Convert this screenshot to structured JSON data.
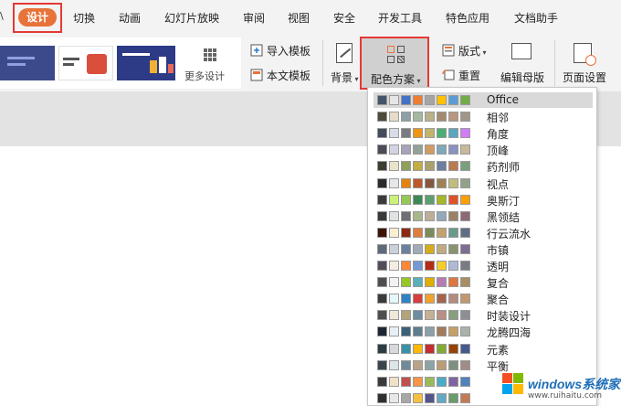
{
  "menubar": {
    "left_glyph": "\\",
    "items": [
      {
        "label": "设计",
        "active": true
      },
      {
        "label": "切换"
      },
      {
        "label": "动画"
      },
      {
        "label": "幻灯片放映"
      },
      {
        "label": "审阅"
      },
      {
        "label": "视图"
      },
      {
        "label": "安全"
      },
      {
        "label": "开发工具"
      },
      {
        "label": "特色应用"
      },
      {
        "label": "文档助手"
      }
    ]
  },
  "ribbon": {
    "more_design_label": "更多设计",
    "import_template_label": "导入模板",
    "this_template_label": "本文模板",
    "background_label": "背景",
    "color_scheme_label": "配色方案",
    "layout_label": "版式",
    "reset_label": "重置",
    "edit_master_label": "编辑母版",
    "page_setup_label": "页面设置"
  },
  "color_schemes": [
    {
      "name": "Office",
      "selected": true,
      "colors": [
        "#44546a",
        "#e7e6e6",
        "#4472c4",
        "#ed7d31",
        "#a5a5a5",
        "#ffc000",
        "#5b9bd5",
        "#70ad47"
      ]
    },
    {
      "name": "相邻",
      "colors": [
        "#4f4a3b",
        "#e6ddc8",
        "#8da0a8",
        "#a4b8a2",
        "#b9b089",
        "#a48a6e",
        "#b99780",
        "#a0968a"
      ]
    },
    {
      "name": "角度",
      "colors": [
        "#434b5c",
        "#d7dde8",
        "#797b7e",
        "#f09415",
        "#c1b56b",
        "#4baf73",
        "#5aa6c0",
        "#d17df9"
      ]
    },
    {
      "name": "顶峰",
      "colors": [
        "#4d4b55",
        "#d2d5e1",
        "#a7a3b9",
        "#93a299",
        "#cf9c66",
        "#7fa8b8",
        "#8a92c0",
        "#c5b99a"
      ]
    },
    {
      "name": "药剂师",
      "colors": [
        "#3a3f2f",
        "#e8e3c9",
        "#8fa05a",
        "#c2ad45",
        "#a9a26a",
        "#6c7f9e",
        "#ba7a4f",
        "#7a9f7f"
      ]
    },
    {
      "name": "视点",
      "colors": [
        "#2b2b2b",
        "#e5e8ea",
        "#e48312",
        "#bd582c",
        "#865640",
        "#9b8357",
        "#c2bc80",
        "#94a088"
      ]
    },
    {
      "name": "奥斯汀",
      "colors": [
        "#3b3b3b",
        "#caf278",
        "#94c954",
        "#3e8853",
        "#5d9f6f",
        "#a6b727",
        "#df5327",
        "#fe9e00"
      ]
    },
    {
      "name": "黑领结",
      "colors": [
        "#3a3a3a",
        "#dfe3e5",
        "#6f6f74",
        "#a7b789",
        "#beae98",
        "#92a9b9",
        "#9c8265",
        "#8d6974"
      ]
    },
    {
      "name": "行云流水",
      "colors": [
        "#3d1209",
        "#f9efd4",
        "#8c2b12",
        "#de7d3f",
        "#7b8b5a",
        "#c2a36e",
        "#699b8c",
        "#5f6f83"
      ]
    },
    {
      "name": "市镇",
      "colors": [
        "#5e6a7b",
        "#c9d2d9",
        "#6b829f",
        "#a0acb9",
        "#d4ad1d",
        "#c0ab81",
        "#8a9370",
        "#7c6e8f"
      ]
    },
    {
      "name": "透明",
      "colors": [
        "#524c58",
        "#f6ede2",
        "#fe8637",
        "#7598d9",
        "#b32c16",
        "#f5cd2d",
        "#aebad5",
        "#777c84"
      ]
    },
    {
      "name": "复合",
      "colors": [
        "#4f4f4f",
        "#f2f2f2",
        "#98c723",
        "#59b0b9",
        "#deae00",
        "#b77bb4",
        "#e0773c",
        "#a98d63"
      ]
    },
    {
      "name": "聚合",
      "colors": [
        "#3b3b3b",
        "#e5f7fd",
        "#2e83c3",
        "#d73f3f",
        "#f0a22e",
        "#a5644e",
        "#b58b80",
        "#c3986d"
      ]
    },
    {
      "name": "时装设计",
      "colors": [
        "#4e4e4e",
        "#f0e8da",
        "#b4a37a",
        "#6e8c9f",
        "#c4b195",
        "#b98f83",
        "#879f7f",
        "#8d8f94"
      ]
    },
    {
      "name": "龙腾四海",
      "colors": [
        "#1b2733",
        "#e7eff5",
        "#3b6079",
        "#5e7d8e",
        "#8d9fa7",
        "#a47a5d",
        "#c5a068",
        "#a9b3aa"
      ]
    },
    {
      "name": "元素",
      "colors": [
        "#2c3c43",
        "#d8d9dc",
        "#3891a7",
        "#feb80a",
        "#c32d2e",
        "#84aa33",
        "#964305",
        "#475a8d"
      ]
    },
    {
      "name": "平衡",
      "colors": [
        "#38454f",
        "#dee5e8",
        "#6f8b99",
        "#b9a489",
        "#8ea3a6",
        "#bb9d75",
        "#7d8f82",
        "#a08d86"
      ]
    },
    {
      "name": "",
      "colors": [
        "#3a3a3a",
        "#f0e2c8",
        "#c0504d",
        "#f79646",
        "#9bbb59",
        "#4bacc6",
        "#8064a2",
        "#4f81bd"
      ]
    },
    {
      "name": "",
      "colors": [
        "#2f2f2f",
        "#e8e8e8",
        "#a7a7a7",
        "#f5c040",
        "#53548a",
        "#66a8c4",
        "#6a9b6a",
        "#c47a53"
      ]
    }
  ],
  "watermark": {
    "title": "windows系统家园",
    "subtitle": "www.ruihaitu.com"
  },
  "colors": {
    "accent_orange": "#e8733a",
    "highlight_red": "#e53935",
    "watermark_blue": "#1f6fb8"
  }
}
